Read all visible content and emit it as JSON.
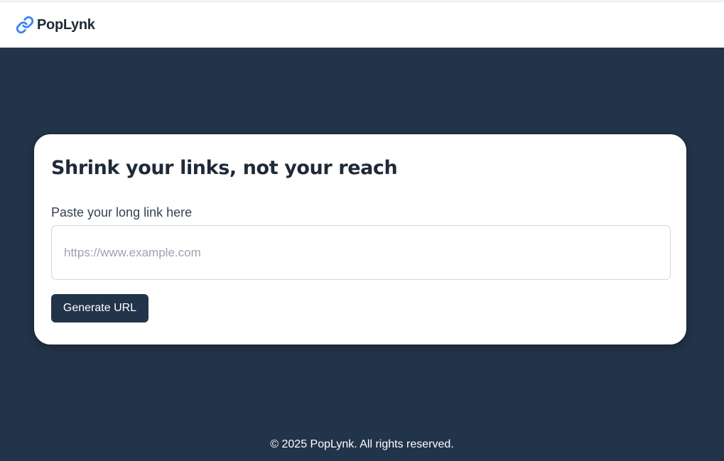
{
  "header": {
    "brand_name": "PopLynk",
    "brand_icon": "link-icon"
  },
  "card": {
    "title": "Shrink your links, not your reach",
    "field_label": "Paste your long link here",
    "input_value": "",
    "input_placeholder": "https://www.example.com",
    "button_label": "Generate URL"
  },
  "footer": {
    "copyright": "© 2025 PopLynk. All rights reserved."
  },
  "colors": {
    "background": "#22344a",
    "card": "#ffffff",
    "button": "#22344a",
    "brand_icon": "#3b82f6",
    "text_dark": "#1f2a37"
  }
}
